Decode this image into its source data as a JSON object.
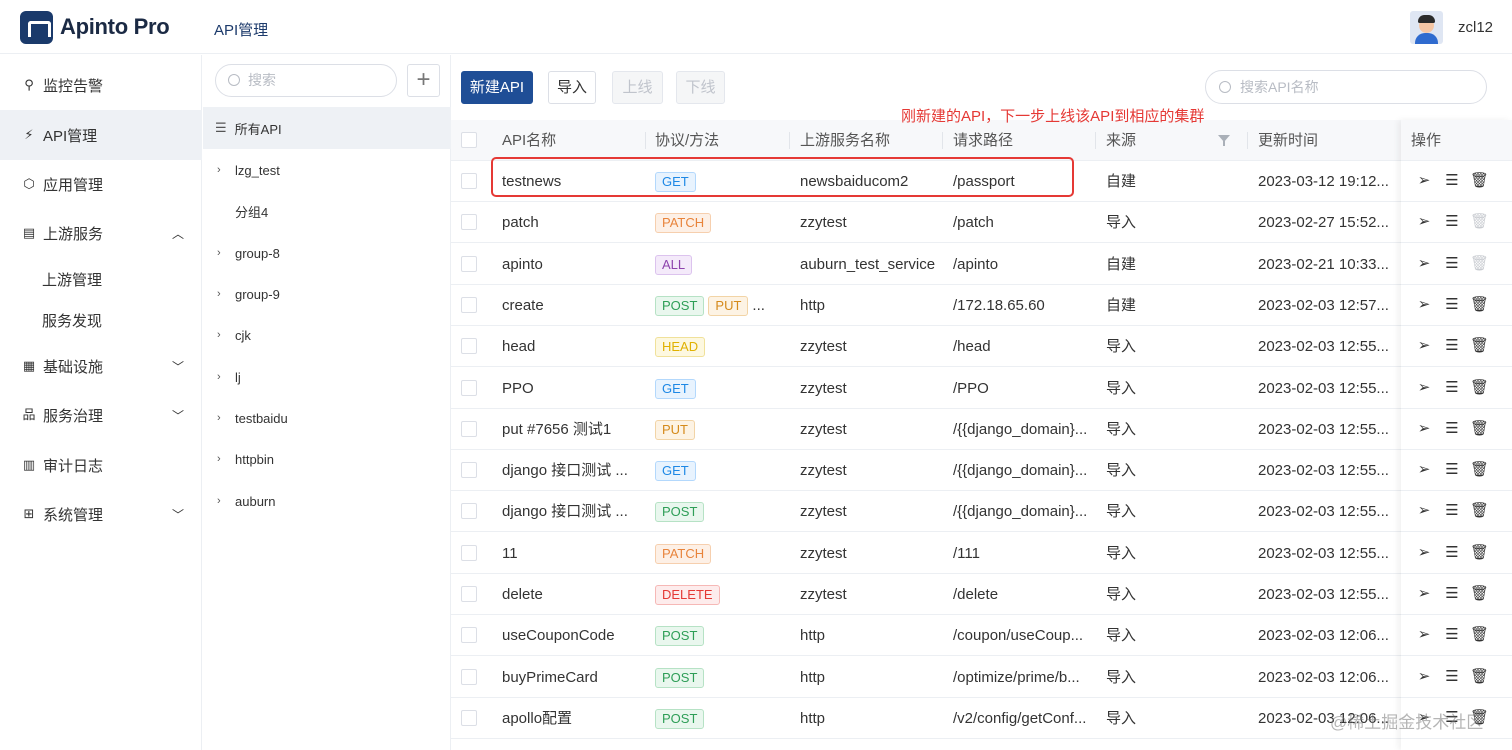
{
  "header": {
    "brand": "Apinto Pro",
    "title": "API管理",
    "username": "zcl12"
  },
  "nav": {
    "items": [
      {
        "label": "监控告警",
        "icon": "location-icon"
      },
      {
        "label": "API管理",
        "icon": "rocket-icon"
      },
      {
        "label": "应用管理",
        "icon": "hexagon-icon"
      },
      {
        "label": "上游服务",
        "icon": "server-icon"
      },
      {
        "label": "基础设施",
        "icon": "grid-icon"
      },
      {
        "label": "服务治理",
        "icon": "org-chart-icon"
      },
      {
        "label": "审计日志",
        "icon": "log-icon"
      },
      {
        "label": "系统管理",
        "icon": "apps-icon"
      }
    ],
    "sub_items": [
      "上游管理",
      "服务发现"
    ]
  },
  "groups": {
    "search_placeholder": "搜索",
    "all_label": "所有API",
    "items": [
      "lzg_test",
      "分组4",
      "group-8",
      "group-9",
      "cjk",
      "lj",
      "testbaidu",
      "httpbin",
      "auburn"
    ]
  },
  "toolbar": {
    "new_api": "新建API",
    "import": "导入",
    "online": "上线",
    "offline": "下线",
    "search_placeholder": "搜索API名称"
  },
  "annotation": "刚新建的API，下一步上线该API到相应的集群",
  "table": {
    "columns": [
      "API名称",
      "协议/方法",
      "上游服务名称",
      "请求路径",
      "来源",
      "更新时间",
      "操作"
    ],
    "rows": [
      {
        "name": "testnews",
        "methods": [
          "GET"
        ],
        "upstream": "newsbaiducom2",
        "path": "/passport",
        "source": "自建",
        "time": "2023-03-12 19:12...",
        "delete_enabled": true
      },
      {
        "name": "patch",
        "methods": [
          "PATCH"
        ],
        "upstream": "zzytest",
        "path": "/patch",
        "source": "导入",
        "time": "2023-02-27 15:52...",
        "delete_enabled": false
      },
      {
        "name": "apinto",
        "methods": [
          "ALL"
        ],
        "upstream": "auburn_test_service",
        "path": "/apinto",
        "source": "自建",
        "time": "2023-02-21 10:33...",
        "delete_enabled": false
      },
      {
        "name": "create",
        "methods": [
          "POST",
          "PUT"
        ],
        "methods_more": "...",
        "upstream": "http",
        "path": "/172.18.65.60",
        "source": "自建",
        "time": "2023-02-03 12:57...",
        "delete_enabled": true
      },
      {
        "name": "head",
        "methods": [
          "HEAD"
        ],
        "upstream": "zzytest",
        "path": "/head",
        "source": "导入",
        "time": "2023-02-03 12:55...",
        "delete_enabled": true
      },
      {
        "name": "PPO",
        "methods": [
          "GET"
        ],
        "upstream": "zzytest",
        "path": "/PPO",
        "source": "导入",
        "time": "2023-02-03 12:55...",
        "delete_enabled": true
      },
      {
        "name": "put #7656 测试1",
        "methods": [
          "PUT"
        ],
        "upstream": "zzytest",
        "path": "/{{django_domain}...",
        "source": "导入",
        "time": "2023-02-03 12:55...",
        "delete_enabled": true
      },
      {
        "name": "django 接口测试 ...",
        "methods": [
          "GET"
        ],
        "upstream": "zzytest",
        "path": "/{{django_domain}...",
        "source": "导入",
        "time": "2023-02-03 12:55...",
        "delete_enabled": true
      },
      {
        "name": "django 接口测试 ...",
        "methods": [
          "POST"
        ],
        "upstream": "zzytest",
        "path": "/{{django_domain}...",
        "source": "导入",
        "time": "2023-02-03 12:55...",
        "delete_enabled": true
      },
      {
        "name": "11",
        "methods": [
          "PATCH"
        ],
        "upstream": "zzytest",
        "path": "/111",
        "source": "导入",
        "time": "2023-02-03 12:55...",
        "delete_enabled": true
      },
      {
        "name": "delete",
        "methods": [
          "DELETE"
        ],
        "upstream": "zzytest",
        "path": "/delete",
        "source": "导入",
        "time": "2023-02-03 12:55...",
        "delete_enabled": true
      },
      {
        "name": "useCouponCode",
        "methods": [
          "POST"
        ],
        "upstream": "http",
        "path": "/coupon/useCoup...",
        "source": "导入",
        "time": "2023-02-03 12:06...",
        "delete_enabled": true
      },
      {
        "name": "buyPrimeCard",
        "methods": [
          "POST"
        ],
        "upstream": "http",
        "path": "/optimize/prime/b...",
        "source": "导入",
        "time": "2023-02-03 12:06...",
        "delete_enabled": true
      },
      {
        "name": "apollo配置",
        "methods": [
          "POST"
        ],
        "upstream": "http",
        "path": "/v2/config/getConf...",
        "source": "导入",
        "time": "2023-02-03 12:06...",
        "delete_enabled": true
      }
    ]
  },
  "method_colors": {
    "GET": {
      "fg": "#1e88e5",
      "bg": "#e8f3fe",
      "border": "#b3d8fc"
    },
    "PATCH": {
      "fg": "#e8843c",
      "bg": "#fdf0e6",
      "border": "#f6cfae"
    },
    "ALL": {
      "fg": "#8e44ad",
      "bg": "#f4eafa",
      "border": "#dcc3ee"
    },
    "POST": {
      "fg": "#2e9e57",
      "bg": "#e9f7ee",
      "border": "#b6e2c5"
    },
    "PUT": {
      "fg": "#d58a1b",
      "bg": "#fdf3e4",
      "border": "#f2d4a6"
    },
    "HEAD": {
      "fg": "#e0b100",
      "bg": "#fdf8e0",
      "border": "#f0e19a"
    },
    "DELETE": {
      "fg": "#e53935",
      "bg": "#fdecec",
      "border": "#f6b8b6"
    }
  },
  "watermark": "@稀土掘金技术社区"
}
